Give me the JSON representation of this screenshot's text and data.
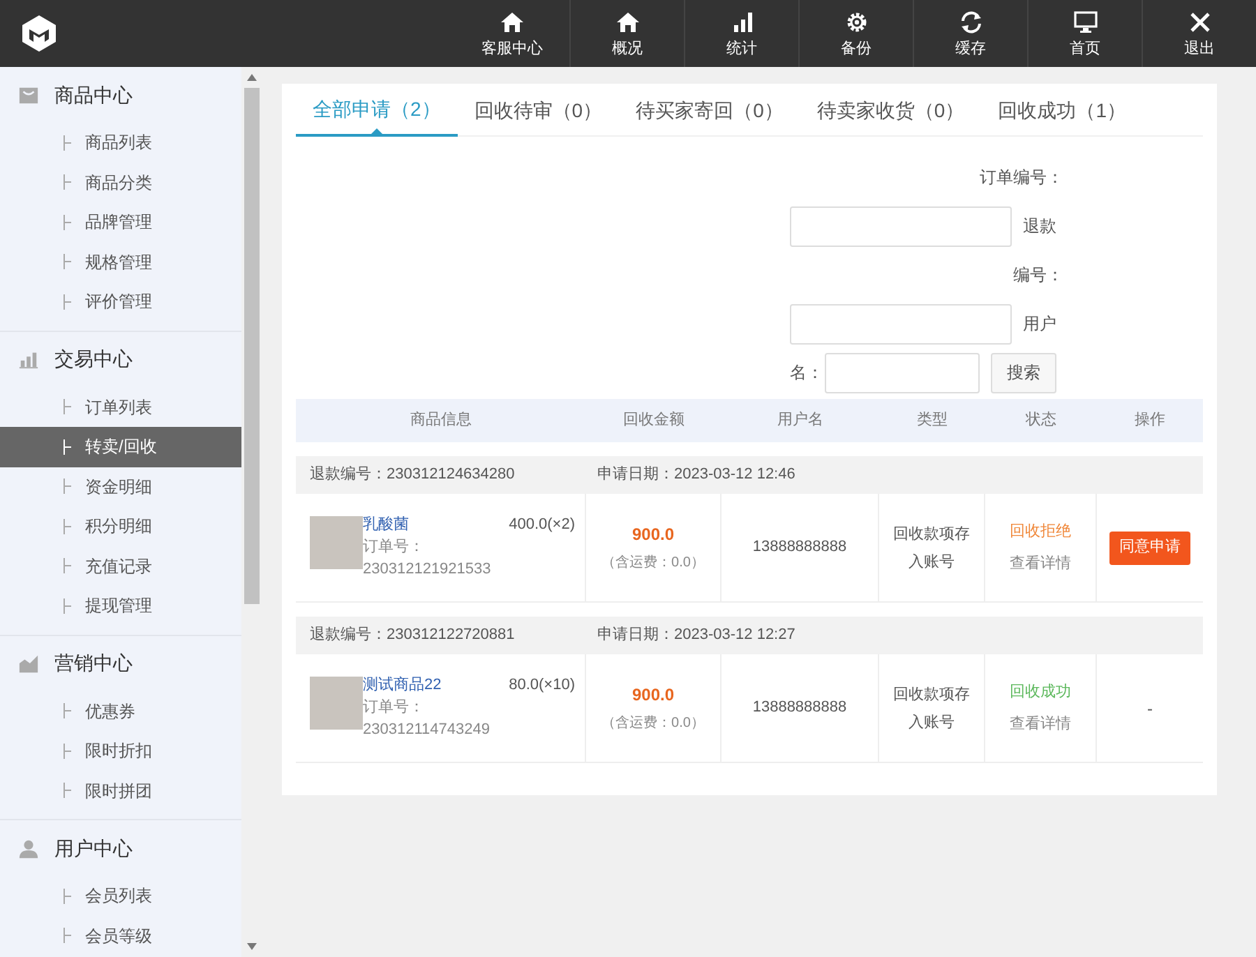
{
  "top_nav": [
    {
      "label": "客服中心"
    },
    {
      "label": "概况"
    },
    {
      "label": "统计"
    },
    {
      "label": "备份"
    },
    {
      "label": "缓存"
    },
    {
      "label": "首页"
    },
    {
      "label": "退出"
    }
  ],
  "sidebar": [
    {
      "title": "商品中心",
      "items": [
        {
          "label": "商品列表",
          "selected": false
        },
        {
          "label": "商品分类",
          "selected": false
        },
        {
          "label": "品牌管理",
          "selected": false
        },
        {
          "label": "规格管理",
          "selected": false
        },
        {
          "label": "评价管理",
          "selected": false
        }
      ]
    },
    {
      "title": "交易中心",
      "items": [
        {
          "label": "订单列表",
          "selected": false
        },
        {
          "label": "转卖/回收",
          "selected": true
        },
        {
          "label": "资金明细",
          "selected": false
        },
        {
          "label": "积分明细",
          "selected": false
        },
        {
          "label": "充值记录",
          "selected": false
        },
        {
          "label": "提现管理",
          "selected": false
        }
      ]
    },
    {
      "title": "营销中心",
      "items": [
        {
          "label": "优惠券",
          "selected": false
        },
        {
          "label": "限时折扣",
          "selected": false
        },
        {
          "label": "限时拼团",
          "selected": false
        }
      ]
    },
    {
      "title": "用户中心",
      "items": [
        {
          "label": "会员列表",
          "selected": false
        },
        {
          "label": "会员等级",
          "selected": false
        }
      ]
    }
  ],
  "tabs": [
    {
      "label": "全部申请（2）",
      "selected": true
    },
    {
      "label": "回收待审（0）",
      "selected": false
    },
    {
      "label": "待买家寄回（0）",
      "selected": false
    },
    {
      "label": "待卖家收货（0）",
      "selected": false
    },
    {
      "label": "回收成功（1）",
      "selected": false
    }
  ],
  "search_form": {
    "fields": [
      {
        "label_parts": [
          "订单编号："
        ]
      },
      {
        "label_parts": [
          "退款",
          "编号："
        ]
      },
      {
        "label_parts": [
          "用户",
          "名："
        ]
      }
    ],
    "search_button": "搜索"
  },
  "table": {
    "columns": [
      "商品信息",
      "回收金额",
      "用户名",
      "类型",
      "状态",
      "操作"
    ],
    "rows": [
      {
        "refund_no": "退款编号：230312124634280",
        "date": "申请日期：2023-03-12 12:46",
        "product": "乳酸菌",
        "price": "400.0(×2)",
        "order_label": "订单号：",
        "order_no": "230312121921533",
        "amount": "900.0",
        "shipping": "（含运费：0.0）",
        "user": "13888888888",
        "type": "回收款项存入账号",
        "status": {
          "kind": "rejected",
          "label": "回收拒绝"
        },
        "detail": "查看详情",
        "action": {
          "kind": "button",
          "label": "同意申请"
        }
      },
      {
        "refund_no": "退款编号：230312122720881",
        "date": "申请日期：2023-03-12 12:27",
        "product": "测试商品22",
        "price": "80.0(×10)",
        "order_label": "订单号：",
        "order_no": "230312114743249",
        "amount": "900.0",
        "shipping": "（含运费：0.0）",
        "user": "13888888888",
        "type": "回收款项存入账号",
        "status": {
          "kind": "success",
          "label": "回收成功"
        },
        "detail": "查看详情",
        "action": {
          "kind": "text",
          "label": "-"
        }
      }
    ]
  }
}
